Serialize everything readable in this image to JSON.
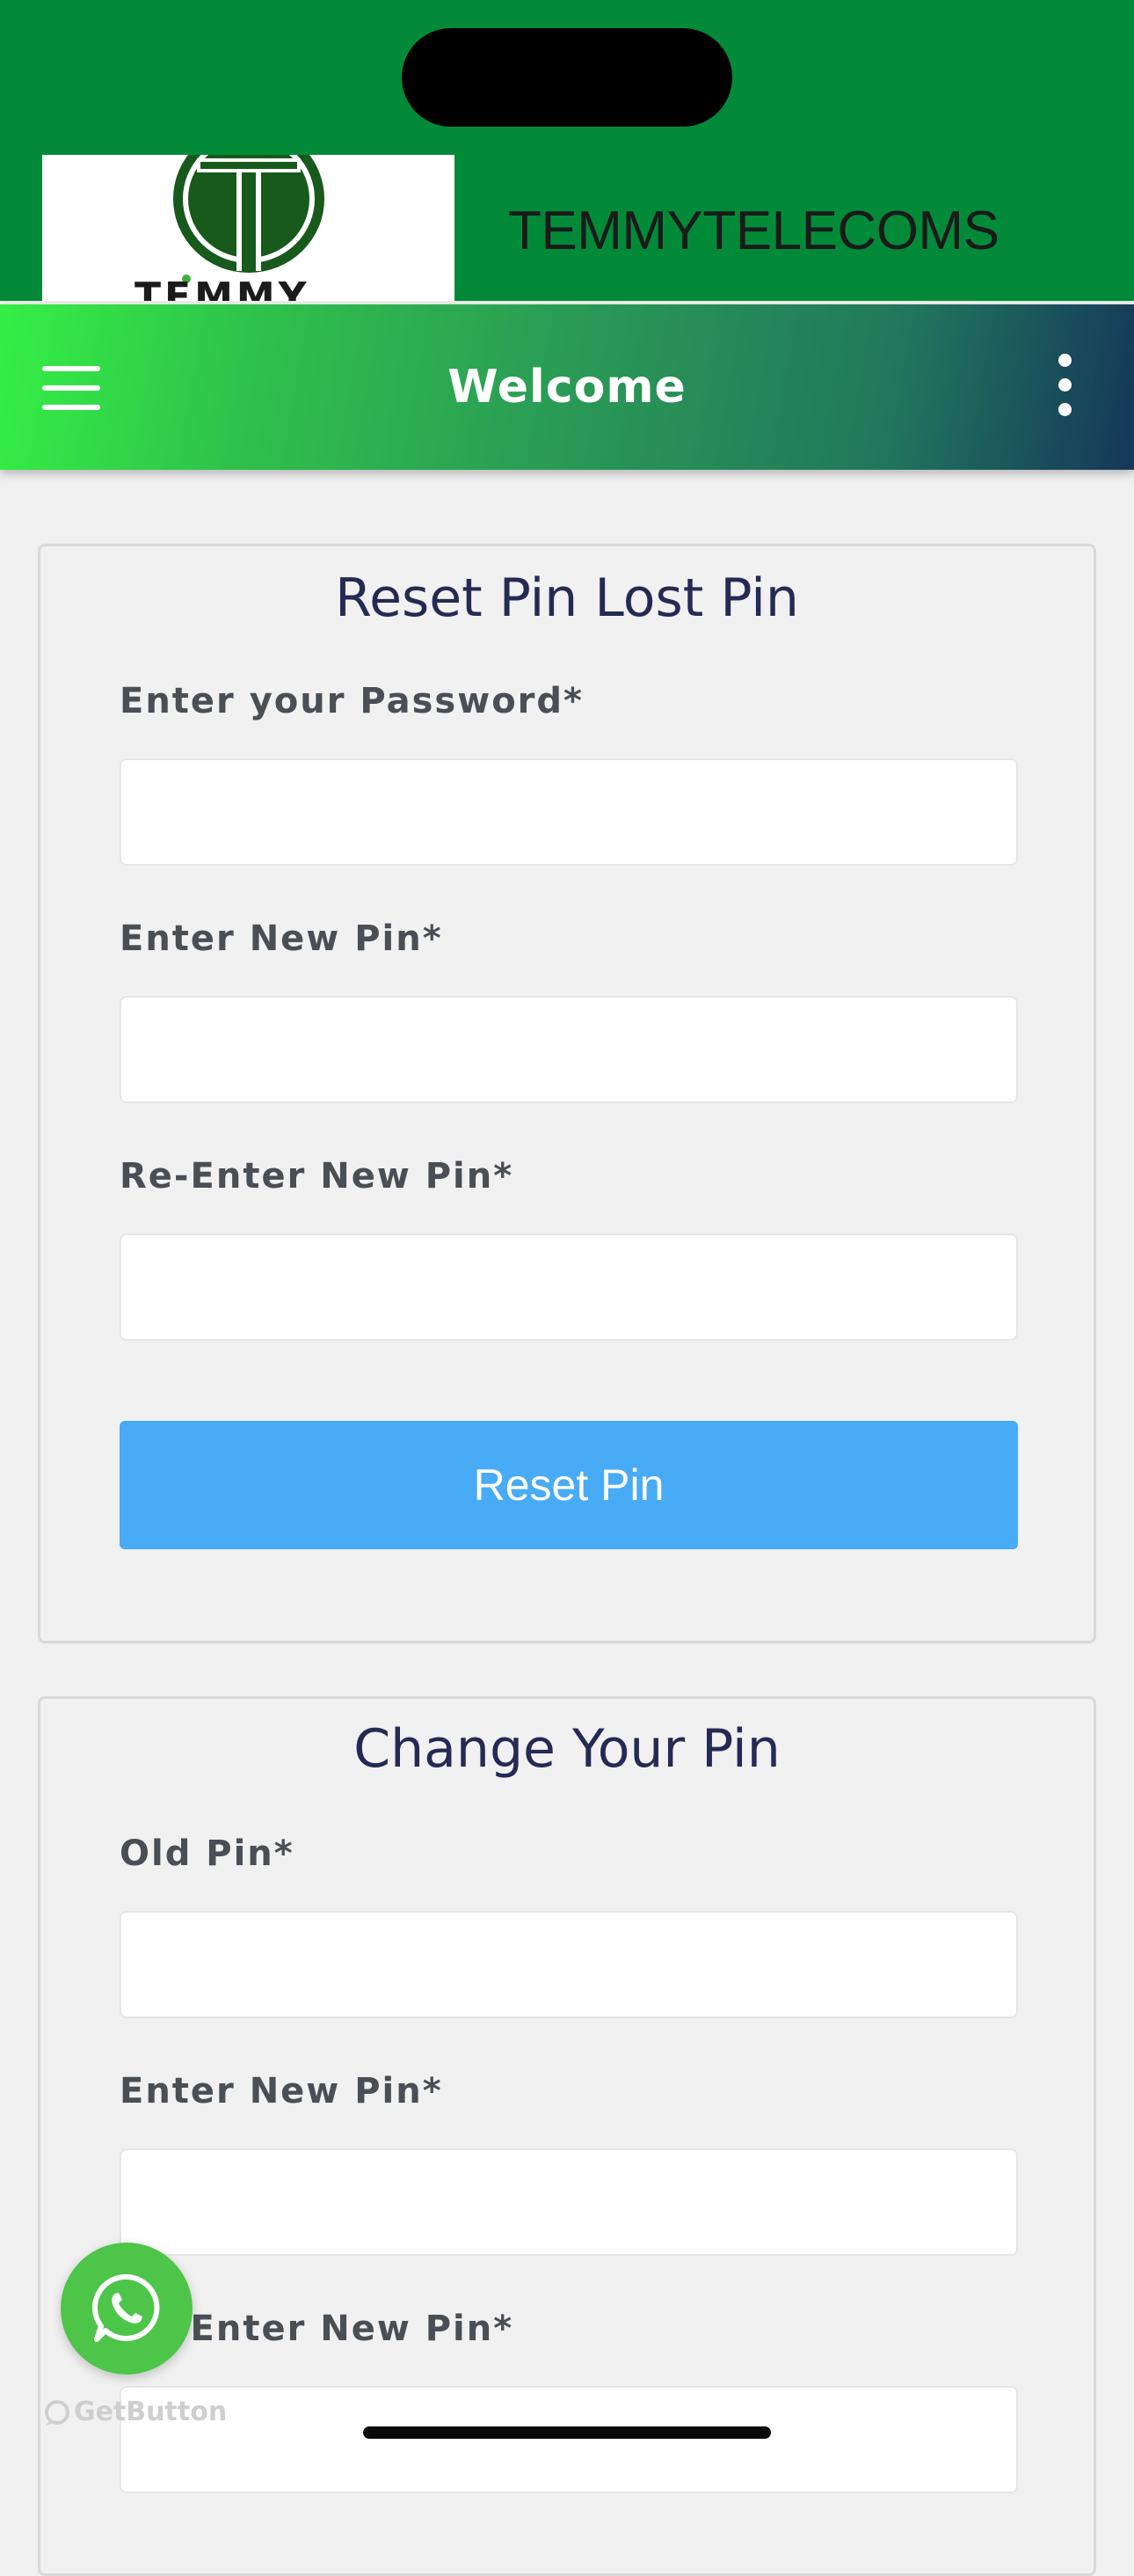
{
  "brand": {
    "logo_text": "TEMMY",
    "name": "TEMMYTELECOMS"
  },
  "app_bar": {
    "title": "Welcome",
    "menu_icon": "hamburger-menu-icon",
    "more_icon": "vertical-dots-icon"
  },
  "reset_card": {
    "title": "Reset Pin Lost Pin",
    "fields": [
      {
        "label": "Enter your Password*",
        "value": "",
        "placeholder": ""
      },
      {
        "label": "Enter New Pin*",
        "value": "",
        "placeholder": ""
      },
      {
        "label": "Re-Enter New Pin*",
        "value": "",
        "placeholder": ""
      }
    ],
    "button_label": "Reset Pin"
  },
  "change_card": {
    "title": "Change Your Pin",
    "fields": [
      {
        "label": "Old Pin*",
        "value": "",
        "placeholder": ""
      },
      {
        "label": "Enter New Pin*",
        "value": "",
        "placeholder": ""
      },
      {
        "label": "Re-Enter New Pin*",
        "value": "",
        "placeholder": ""
      }
    ]
  },
  "widgets": {
    "whatsapp_icon": "whatsapp-icon",
    "credit_text": "GetButton"
  },
  "colors": {
    "brand_green": "#028a39",
    "app_bar_gradient_start": "#35ef45",
    "app_bar_gradient_end": "#15375a",
    "primary_button": "#48abf6",
    "card_title": "#252a55",
    "whatsapp_green": "#4cc549"
  }
}
